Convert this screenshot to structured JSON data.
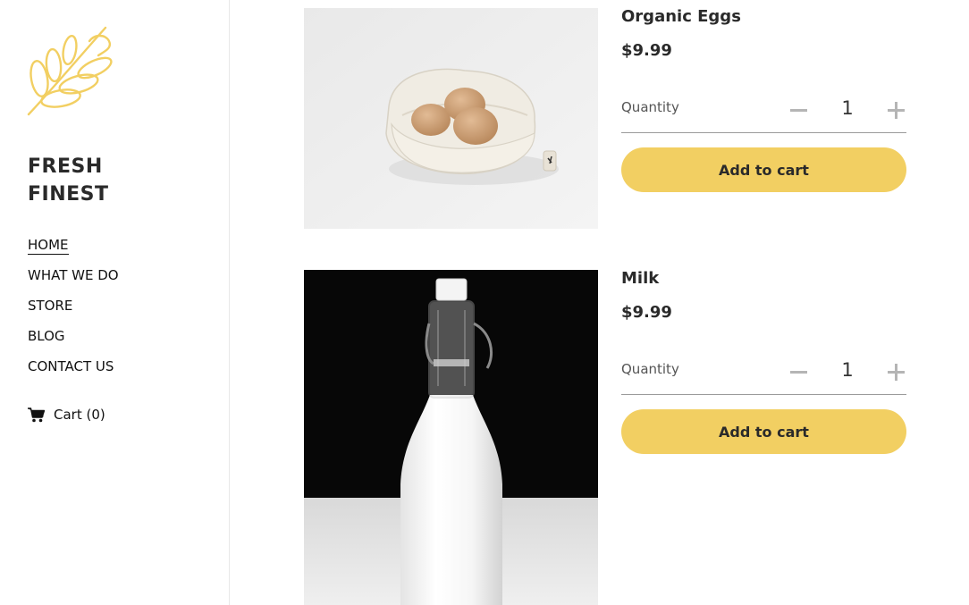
{
  "brand": {
    "line1": "FRESH",
    "line2": "FINEST",
    "logo_icon": "wheat-icon",
    "accent_color": "#f2cf62"
  },
  "nav": {
    "items": [
      {
        "label": "HOME",
        "active": true
      },
      {
        "label": "WHAT WE DO"
      },
      {
        "label": "STORE"
      },
      {
        "label": "BLOG"
      },
      {
        "label": "CONTACT US"
      }
    ],
    "cart_label": "Cart (0)",
    "cart_icon": "shopping-cart-icon"
  },
  "products": [
    {
      "name": "Organic Eggs",
      "price": "$9.99",
      "quantity_label": "Quantity",
      "quantity": "1",
      "add_label": "Add to cart"
    },
    {
      "name": "Milk",
      "price": "$9.99",
      "quantity_label": "Quantity",
      "quantity": "1",
      "add_label": "Add to cart"
    }
  ]
}
